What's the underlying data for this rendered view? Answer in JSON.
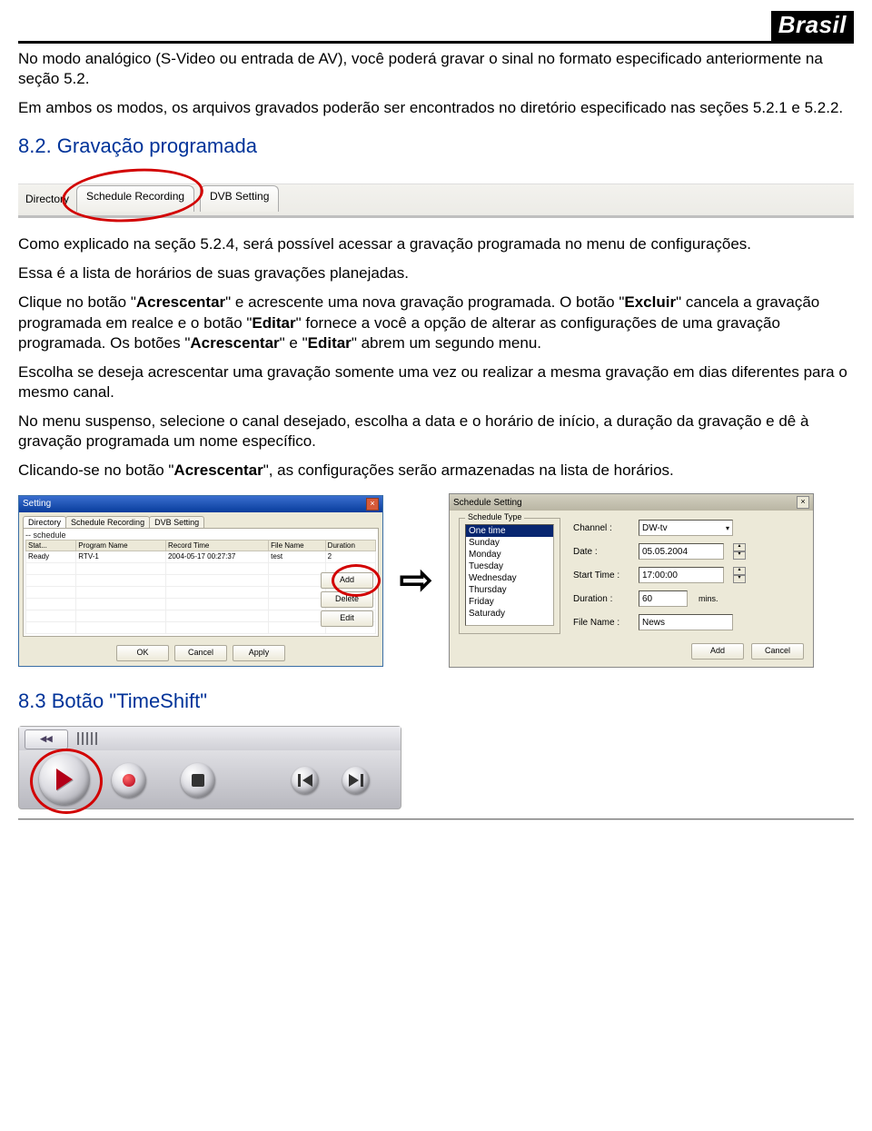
{
  "brand": "Brasil",
  "intro": {
    "p1": "No modo analógico (S-Video ou entrada de AV), você poderá gravar o sinal no formato especificado anteriormente na seção 5.2.",
    "p2": "Em ambos os modos, os arquivos gravados poderão ser encontrados no diretório especificado nas seções 5.2.1 e 5.2.2."
  },
  "sec82_title": "8.2. Gravação programada",
  "fig_tabs": {
    "directory_label": "Directory",
    "tab_schedule": "Schedule Recording",
    "tab_dvb": "DVB Setting"
  },
  "body82": {
    "p1a": "Como explicado na seção 5.2.4, será possível acessar a gravação programada no menu de configurações.",
    "p2": "Essa é a lista de horários de suas gravações planejadas.",
    "p3_pre": "Clique no botão \"",
    "p3_b1": "Acrescentar",
    "p3_mid1": "\" e acrescente uma nova gravação programada. O botão \"",
    "p3_b2": "Excluir",
    "p3_mid2": "\" cancela a gravação programada em realce e o botão \"",
    "p3_b3": "Editar",
    "p3_mid3": "\" fornece a você a opção de alterar as configurações de uma gravação programada. Os botões \"",
    "p3_b4": "Acrescentar",
    "p3_mid4": "\" e \"",
    "p3_b5": "Editar",
    "p3_post": "\" abrem um segundo menu.",
    "p4": "Escolha se deseja acrescentar uma gravação somente uma vez ou realizar a mesma gravação em dias diferentes para o mesmo canal.",
    "p5": "No menu suspenso, selecione o canal desejado, escolha a data e o horário de início, a duração da gravação e dê à gravação programada um nome específico.",
    "p6_pre": "Clicando-se no botão \"",
    "p6_b": "Acrescentar",
    "p6_post": "\", as configurações serão armazenadas na lista de horários."
  },
  "winA": {
    "title": "Setting",
    "tab1": "Directory",
    "tab2": "Schedule Recording",
    "tab3": "DVB Setting",
    "list_label": "-- schedule",
    "cols": [
      "Stat...",
      "Program Name",
      "Record Time",
      "File Name",
      "Duration"
    ],
    "row": [
      "Ready",
      "RTV-1",
      "2004-05-17 00:27:37",
      "test",
      "2"
    ],
    "btn_add": "Add",
    "btn_delete": "Delete",
    "btn_edit": "Edit",
    "btn_ok": "OK",
    "btn_cancel": "Cancel",
    "btn_apply": "Apply"
  },
  "arrow": "⇨",
  "winB": {
    "title": "Schedule Setting",
    "group": "Schedule Type",
    "items": [
      "One time",
      "Sunday",
      "Monday",
      "Tuesday",
      "Wednesday",
      "Thursday",
      "Friday",
      "Saturady"
    ],
    "lbl_channel": "Channel :",
    "val_channel": "DW-tv",
    "lbl_date": "Date :",
    "val_date": "05.05.2004",
    "lbl_start": "Start Time :",
    "val_start": "17:00:00",
    "lbl_duration": "Duration :",
    "val_duration": "60",
    "mins": "mins.",
    "lbl_file": "File Name :",
    "val_file": "News",
    "btn_add": "Add",
    "btn_cancel": "Cancel"
  },
  "sec83_title": "8.3 Botão \"TimeShift\"",
  "player": {
    "rewind": "◂◂"
  }
}
